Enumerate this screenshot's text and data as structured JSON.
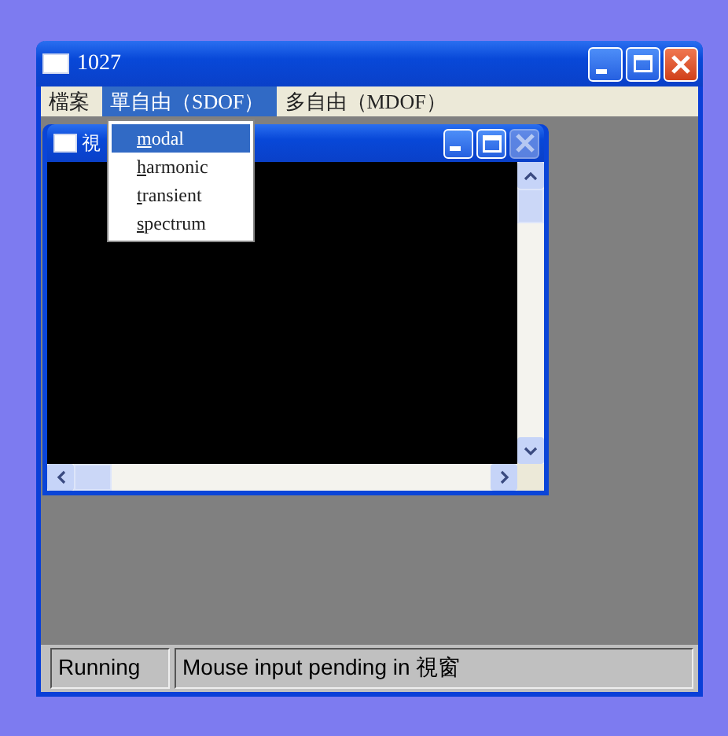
{
  "window": {
    "title": "1027",
    "buttons": [
      {
        "kind": "minimize",
        "disabled": false
      },
      {
        "kind": "maximize",
        "disabled": false
      },
      {
        "kind": "close",
        "disabled": false
      }
    ]
  },
  "menu_bar": [
    {
      "label": "檔案",
      "selected": false
    },
    {
      "label": "單自由（SDOF）",
      "selected": true
    },
    {
      "label": "多自由（MDOF）",
      "selected": false
    }
  ],
  "dropdown": [
    {
      "label": "modal",
      "selected": true
    },
    {
      "label": "harmonic",
      "selected": false
    },
    {
      "label": "transient",
      "selected": false
    },
    {
      "label": "spectrum",
      "selected": false
    }
  ],
  "child_window": {
    "title": "視",
    "buttons": [
      {
        "kind": "minimize",
        "disabled": false
      },
      {
        "kind": "maximize",
        "disabled": false
      },
      {
        "kind": "close",
        "disabled": true
      }
    ]
  },
  "status_bar": [
    "Running",
    "Mouse input pending in 視窗"
  ]
}
